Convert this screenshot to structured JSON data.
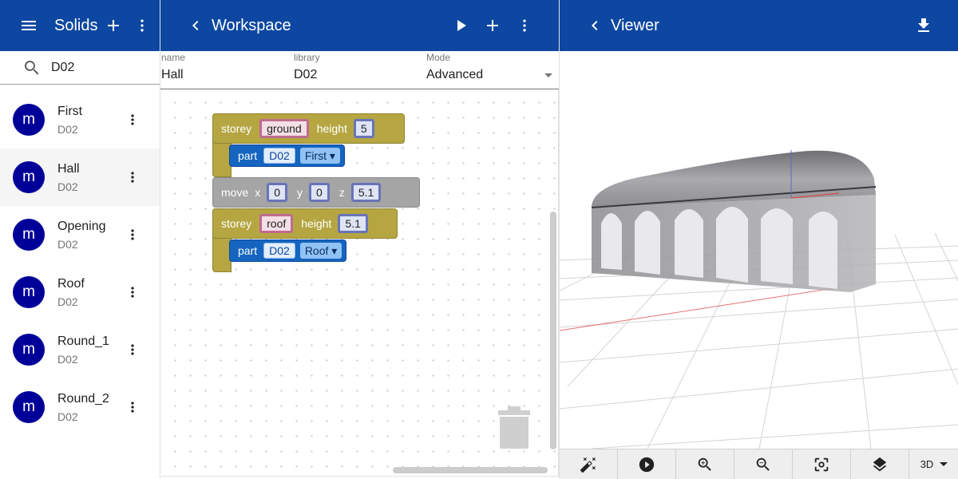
{
  "solids_panel": {
    "title": "Solids",
    "search": {
      "value": "D02",
      "icon": "search-icon"
    },
    "items": [
      {
        "letter": "m",
        "title": "First",
        "library": "D02",
        "selected": false
      },
      {
        "letter": "m",
        "title": "Hall",
        "library": "D02",
        "selected": true
      },
      {
        "letter": "m",
        "title": "Opening",
        "library": "D02",
        "selected": false
      },
      {
        "letter": "m",
        "title": "Roof",
        "library": "D02",
        "selected": false
      },
      {
        "letter": "m",
        "title": "Round_1",
        "library": "D02",
        "selected": false
      },
      {
        "letter": "m",
        "title": "Round_2",
        "library": "D02",
        "selected": false
      }
    ]
  },
  "workspace_panel": {
    "title": "Workspace",
    "fields": {
      "name": {
        "label": "name",
        "value": "Hall"
      },
      "library": {
        "label": "library",
        "value": "D02"
      },
      "mode": {
        "label": "Mode",
        "value": "Advanced"
      }
    },
    "blocks": {
      "storey1": {
        "keyword": "storey",
        "name": "ground",
        "height_label": "height",
        "height": "5"
      },
      "part1": {
        "keyword": "part",
        "library": "D02",
        "solid": "First"
      },
      "move": {
        "keyword": "move",
        "x_label": "x",
        "x": "0",
        "y_label": "y",
        "y": "0",
        "z_label": "z",
        "z": "5.1"
      },
      "storey2": {
        "keyword": "storey",
        "name": "roof",
        "height_label": "height",
        "height": "5.1"
      },
      "part2": {
        "keyword": "part",
        "library": "D02",
        "solid": "Roof"
      }
    }
  },
  "viewer_panel": {
    "title": "Viewer",
    "toolbar": {
      "icons": [
        "magic-wand-icon",
        "play-circle-icon",
        "zoom-in-icon",
        "zoom-out-icon",
        "fit-view-icon",
        "layers-icon"
      ],
      "view_mode": "3D"
    }
  },
  "colors": {
    "appbar": "#0d47a1",
    "avatar": "#000099",
    "storey_block": "#b5a642",
    "move_block": "#a5a5a5",
    "part_block": "#1565c0"
  }
}
